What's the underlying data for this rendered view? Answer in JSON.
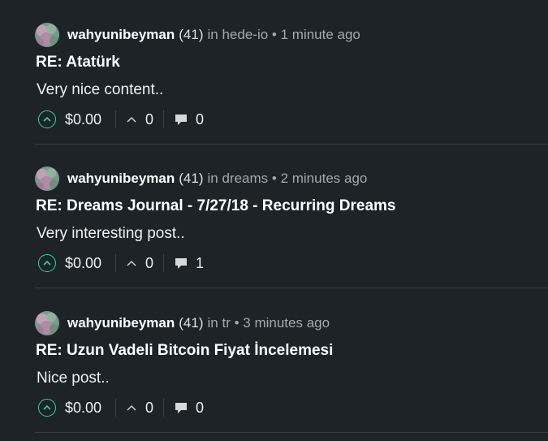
{
  "posts": [
    {
      "author": "wahyunibeyman",
      "reputation": "(41)",
      "community_prefix": "in",
      "community": "hede-io",
      "time": "• 1 minute ago",
      "title": "RE: Atatürk",
      "body": "Very nice content..",
      "payout": "$0.00",
      "votes": "0",
      "comments": "0"
    },
    {
      "author": "wahyunibeyman",
      "reputation": "(41)",
      "community_prefix": "in",
      "community": "dreams",
      "time": "• 2 minutes ago",
      "title": "RE: Dreams Journal - 7/27/18 - Recurring Dreams",
      "body": "Very interesting post..",
      "payout": "$0.00",
      "votes": "0",
      "comments": "1"
    },
    {
      "author": "wahyunibeyman",
      "reputation": "(41)",
      "community_prefix": "in",
      "community": "tr",
      "time": "• 3 minutes ago",
      "title": "RE: Uzun Vadeli Bitcoin Fiyat İncelemesi",
      "body": "Nice post..",
      "payout": "$0.00",
      "votes": "0",
      "comments": "0"
    }
  ],
  "colors": {
    "background": "#1d2327",
    "upvote_accent": "#2dd4a0",
    "separator": "#343b41",
    "muted_text": "#a8a8a8"
  },
  "icons": {
    "upvote": "upvote-circle-icon",
    "votes": "chevron-up-icon",
    "comments": "comment-bubble-icon"
  }
}
